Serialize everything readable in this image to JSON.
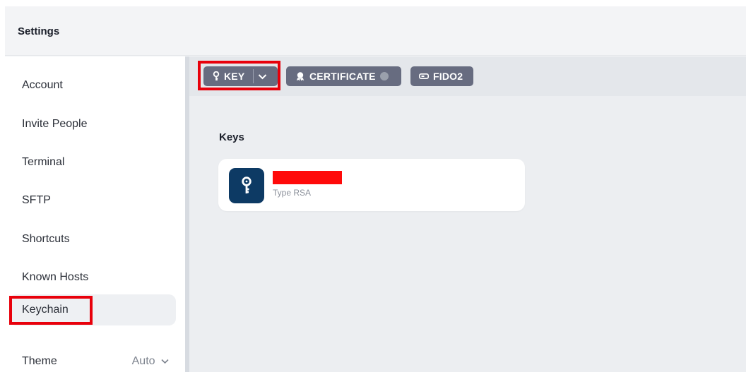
{
  "header": {
    "title": "Settings"
  },
  "sidebar": {
    "items": [
      {
        "label": "Account"
      },
      {
        "label": "Invite People"
      },
      {
        "label": "Terminal"
      },
      {
        "label": "SFTP"
      },
      {
        "label": "Shortcuts"
      },
      {
        "label": "Known Hosts"
      },
      {
        "label": "Keychain",
        "active": true
      }
    ],
    "theme": {
      "label": "Theme",
      "value": "Auto"
    }
  },
  "toolbar": {
    "key_label": "KEY",
    "certificate_label": "CERTIFICATE",
    "fido2_label": "FIDO2"
  },
  "keys": {
    "section_title": "Keys",
    "items": [
      {
        "name": "",
        "type": "Type RSA"
      }
    ]
  },
  "colors": {
    "highlight": "#e8000b",
    "button": "#676c80",
    "key_icon_bg": "#0d3a64"
  }
}
